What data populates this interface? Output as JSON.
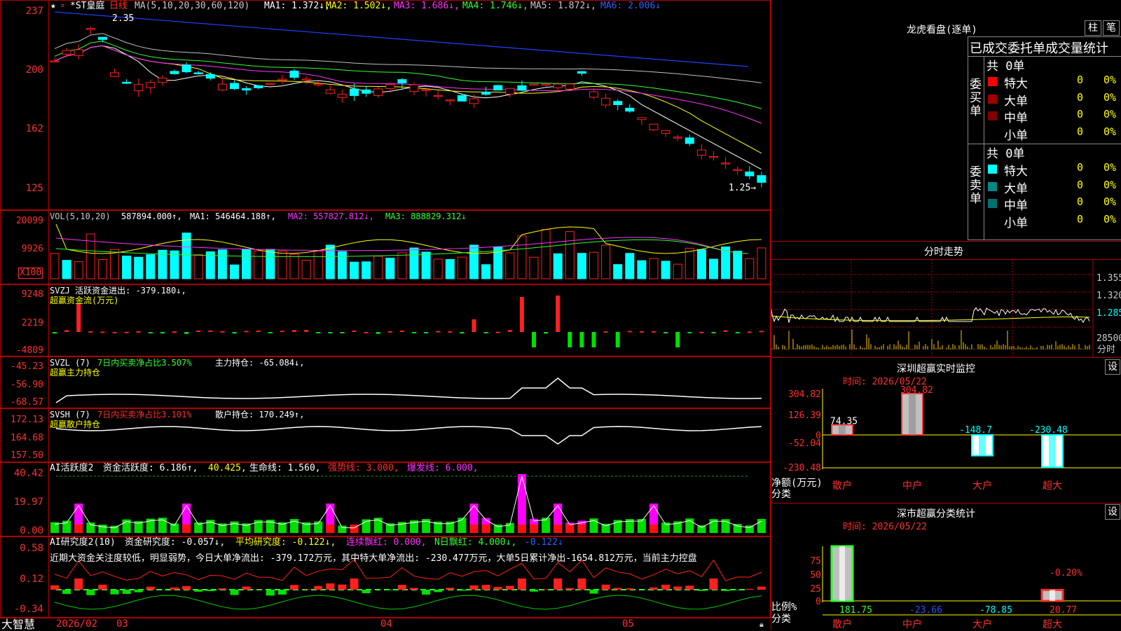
{
  "main": {
    "header": {
      "symbol": "*ST皇庭",
      "period": "日线",
      "ma_title": "MA(5,10,20,30,60,120)",
      "ma1": "MA1: 1.372↓,",
      "ma2": "MA2: 1.502↓,",
      "ma3": "MA3: 1.686↓,",
      "ma4": "MA4: 1.746↓,",
      "ma5": "MA5: 1.872↓,",
      "ma6": "MA6: 2.006↓"
    },
    "y_ticks": [
      "237",
      "200",
      "162",
      "125"
    ],
    "high_label": "2.35",
    "low_label": "1.25→",
    "colors": {
      "up": "#ff2020",
      "down": "#00ffff",
      "ma5": "#ffffff",
      "ma10": "#ffff00",
      "ma20": "#ff33ff",
      "ma30": "#33ff33",
      "ma60": "#c0c0c0",
      "ma120": "#2040ff"
    }
  },
  "vol": {
    "title": "VOL(5,10,20)",
    "value": "587894.000↑,",
    "ma1": "MA1: 546464.188↑,",
    "ma2": "MA2: 557827.812↓,",
    "ma3": "MA3: 888829.312↓",
    "y_ticks": [
      "20099",
      "9926"
    ],
    "unit": "X100"
  },
  "svzj": {
    "title": "SVZJ  活跃资金进出: -379.180↓,",
    "subtitle": "超赢资金流(万元)",
    "y_ticks": [
      "9248",
      "2219",
      "-4809"
    ]
  },
  "svzl": {
    "title": "SVZL (7)",
    "ratio": "7日内买卖净占比3.507%",
    "hold": "主力持仓: -65.084↓,",
    "subtitle": "超赢主力持仓",
    "y_ticks": [
      "-45.23",
      "-56.90",
      "-68.57"
    ]
  },
  "svsh": {
    "title": "SVSH (7)",
    "ratio": "7日内买卖净占比3.101%",
    "hold": "散户持仓: 170.249↑,",
    "subtitle": "超赢散户持仓",
    "y_ticks": [
      "172.13",
      "164.68",
      "157.50"
    ]
  },
  "ai_active": {
    "title": "AI活跃度2",
    "a": "资金活跃度: 6.186↑,",
    "b": "40.425,",
    "c": "生命线: 1.560,",
    "d": "强势线: 3.000,",
    "e": "爆发线: 6.000,",
    "y_ticks": [
      "40.42",
      "19.97",
      "0.00"
    ]
  },
  "ai_research": {
    "title": "AI研究度2(10)",
    "a": "资金研究度: -0.057↓,",
    "b": "平均研究度: -0.122↓,",
    "c": "连续飘红: 0.000,",
    "d": "N日飘红: 4.000↓,",
    "e": "-0.122↓",
    "comment": "近期大资金关注度较低，明显弱势，今日大单净流出: -379.172万元，其中特大单净流出: -230.477万元，大单5日累计净出-1654.812万元，当前主力控盘",
    "y_ticks": [
      "0.58",
      "0.12",
      "-0.34"
    ]
  },
  "bottom_axis": {
    "brand": "大智慧",
    "labels": [
      "2026/02",
      "03",
      "04",
      "05"
    ]
  },
  "dragon": {
    "title": "龙虎看盘(逐单)",
    "btn1": "柱",
    "btn2": "笔",
    "subtitle": "已成交委托单成交量统计",
    "buy_side": "委买单",
    "sell_side": "委卖单",
    "buy_total": "共 0单",
    "sell_total": "共 0单",
    "buy_rows": [
      {
        "label": "特大",
        "count": "0",
        "pct": "0%",
        "color": "#ff0000"
      },
      {
        "label": "大单",
        "count": "0",
        "pct": "0%",
        "color": "#a00000"
      },
      {
        "label": "中单",
        "count": "0",
        "pct": "0%",
        "color": "#800000"
      },
      {
        "label": "小单",
        "count": "0",
        "pct": "0%",
        "color": ""
      }
    ],
    "sell_rows": [
      {
        "label": "特大",
        "count": "0",
        "pct": "0%",
        "color": "#00ffff"
      },
      {
        "label": "大单",
        "count": "0",
        "pct": "0%",
        "color": "#008888"
      },
      {
        "label": "中单",
        "count": "0",
        "pct": "0%",
        "color": "#007070"
      },
      {
        "label": "小单",
        "count": "0",
        "pct": "0%",
        "color": ""
      }
    ]
  },
  "intraday": {
    "title": "分时走势",
    "y_ticks": [
      "1.355",
      "1.320",
      "1.285"
    ],
    "vol_tick": "28500",
    "vol_label": "分时"
  },
  "sz_monitor": {
    "title": "深圳超赢实时监控",
    "btn": "设",
    "time": "时间: 2026/05/22",
    "y_ticks": [
      "304.82",
      "126.39",
      "0",
      "-52.04",
      "-230.48"
    ],
    "ylabel": "净额(万元)",
    "xlabel": "分类",
    "categories": [
      "散户",
      "中户",
      "大户",
      "超大"
    ],
    "values": [
      74.35,
      304.82,
      -148.7,
      -230.48
    ],
    "value_labels": [
      "74.35",
      "304.82",
      "-148.7",
      "-230.48"
    ]
  },
  "sz_class": {
    "title": "深市超赢分类统计",
    "btn": "设",
    "time": "时间: 2026/05/22",
    "y_ticks": [
      "75",
      "50",
      "25",
      "0"
    ],
    "ylabel": "比例%",
    "xlabel": "分类",
    "categories": [
      "散户",
      "中户",
      "大户",
      "超大"
    ],
    "values": [
      181.75,
      -23.66,
      -78.85,
      20.77
    ],
    "value_labels": [
      "181.75",
      "-23.66",
      "-78.85",
      "20.77"
    ],
    "top_label": "-0.20%"
  }
}
